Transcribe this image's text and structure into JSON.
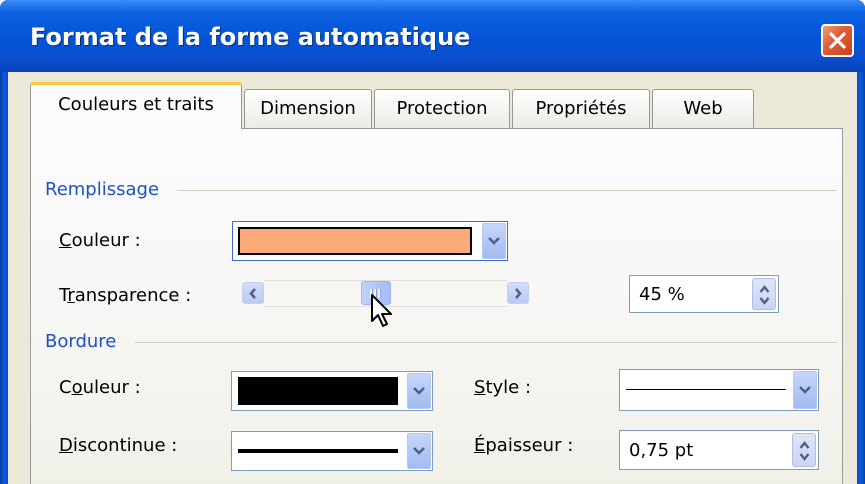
{
  "window": {
    "title": "Format de la forme automatique",
    "close_icon": "close-icon"
  },
  "tabs": [
    {
      "label": "Couleurs et traits",
      "active": true
    },
    {
      "label": "Dimension",
      "active": false
    },
    {
      "label": "Protection",
      "active": false
    },
    {
      "label": "Propriétés",
      "active": false
    },
    {
      "label": "Web",
      "active": false
    }
  ],
  "fill_section": {
    "heading": "Remplissage",
    "color_label_underlined": "C",
    "color_label_rest": "ouleur :",
    "color_value": "#fcaa7a",
    "transparency_label_pre": "T",
    "transparency_label_underlined": "r",
    "transparency_label_post": "ansparence :",
    "transparency_value": "45 %",
    "transparency_percent": 45
  },
  "border_section": {
    "heading": "Bordure",
    "color_label_pre": "C",
    "color_label_underlined": "o",
    "color_label_post": "uleur :",
    "color_value": "#000000",
    "style_label_underlined": "S",
    "style_label_rest": "tyle :",
    "dash_label_underlined": "D",
    "dash_label_rest": "iscontinue :",
    "weight_label_underlined": "É",
    "weight_label_rest": "paisseur :",
    "weight_value": "0,75 pt"
  },
  "colors": {
    "accent_heading": "#1e50c8",
    "titlebar": "#0554d8",
    "tab_highlight": "#ffc83c"
  }
}
